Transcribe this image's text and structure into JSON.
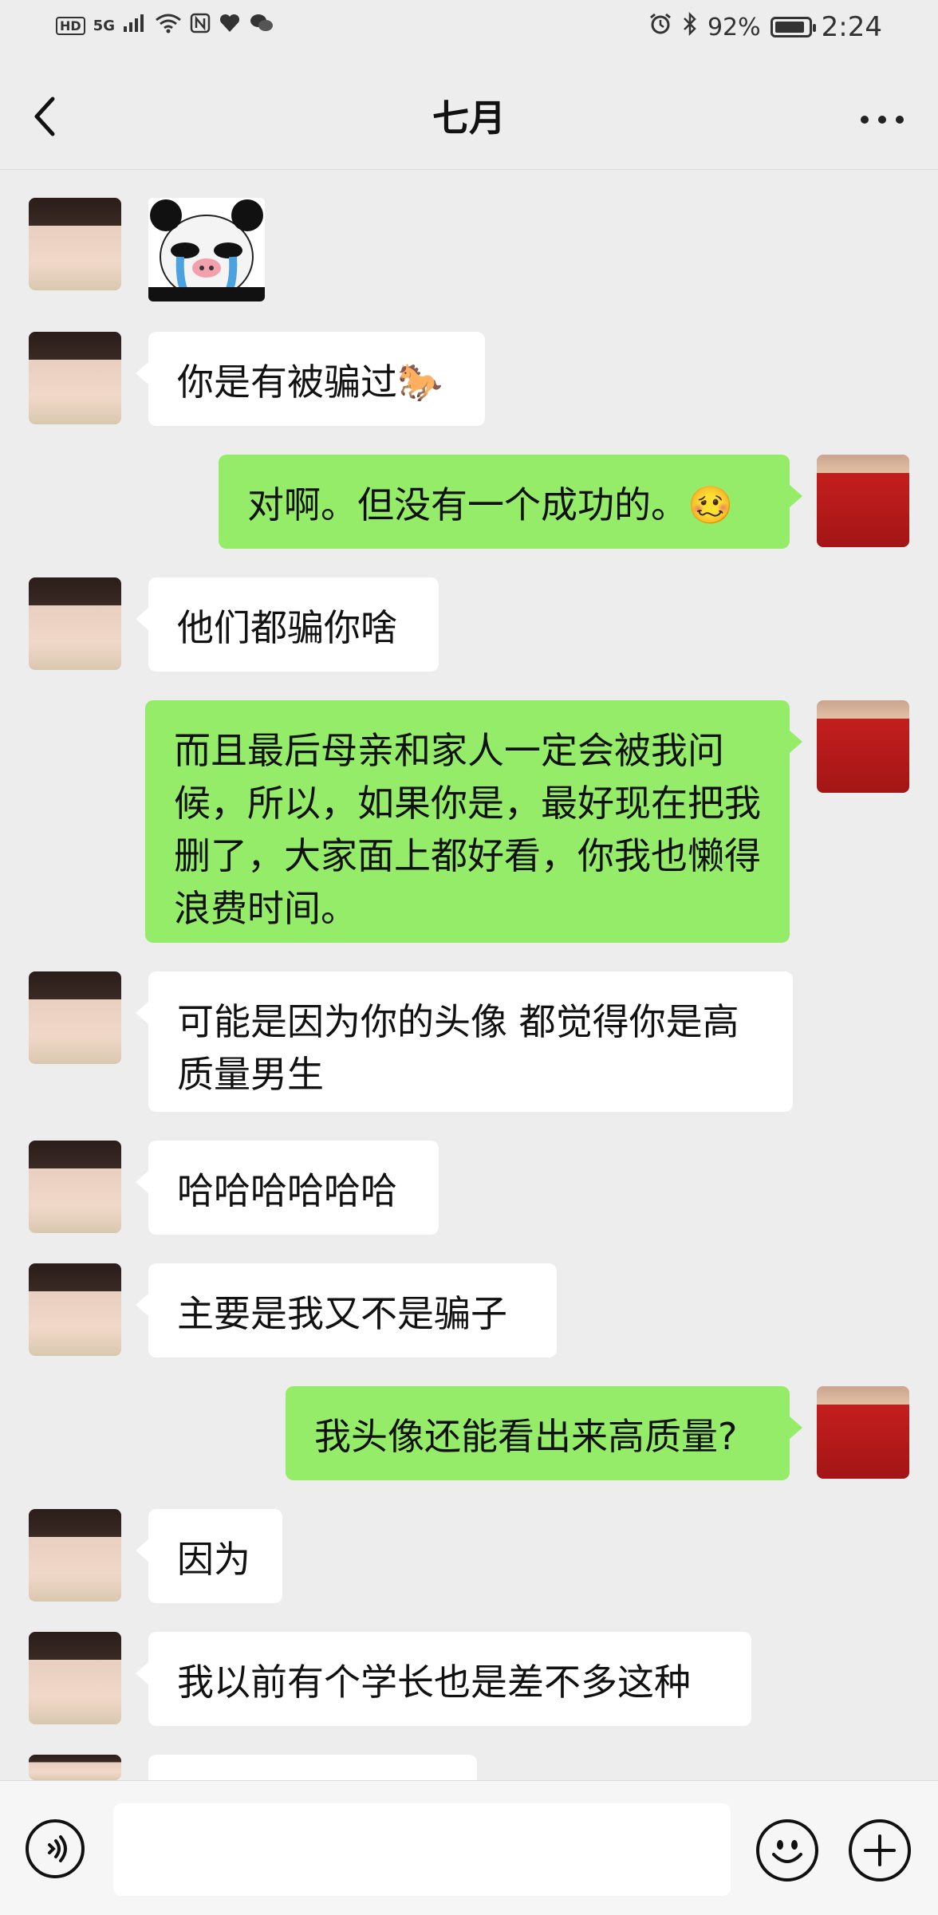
{
  "status_bar": {
    "hd": "HD",
    "network": "5G",
    "battery_percent": "92%",
    "battery_level": 0.92,
    "time": "2:24"
  },
  "header": {
    "title": "七月",
    "back_icon": "chevron-left-icon",
    "more_icon": "more-dots-icon"
  },
  "messages": [
    {
      "side": "left",
      "type": "sticker",
      "sticker": "panda-crying-sticker"
    },
    {
      "side": "left",
      "type": "text",
      "text": "你是有被骗过🐎"
    },
    {
      "side": "right",
      "type": "text",
      "text": "对啊。但没有一个成功的。🥴"
    },
    {
      "side": "left",
      "type": "text",
      "text": "他们都骗你啥"
    },
    {
      "side": "right",
      "type": "text",
      "text": "而且最后母亲和家人一定会被我问候，所以，如果你是，最好现在把我删了，大家面上都好看，你我也懒得浪费时间。"
    },
    {
      "side": "left",
      "type": "text",
      "text": "可能是因为你的头像 都觉得你是高质量男生"
    },
    {
      "side": "left",
      "type": "text",
      "text": "哈哈哈哈哈哈"
    },
    {
      "side": "left",
      "type": "text",
      "text": "主要是我又不是骗子"
    },
    {
      "side": "right",
      "type": "text",
      "text": "我头像还能看出来高质量?"
    },
    {
      "side": "left",
      "type": "text",
      "text": "因为"
    },
    {
      "side": "left",
      "type": "text",
      "text": "我以前有个学长也是差不多这种"
    }
  ],
  "input_bar": {
    "voice_icon": "voice-icon",
    "emoji_icon": "emoji-icon",
    "plus_icon": "plus-icon",
    "input_value": ""
  },
  "colors": {
    "background": "#ededed",
    "outgoing_bubble": "#95ec69",
    "incoming_bubble": "#ffffff"
  }
}
